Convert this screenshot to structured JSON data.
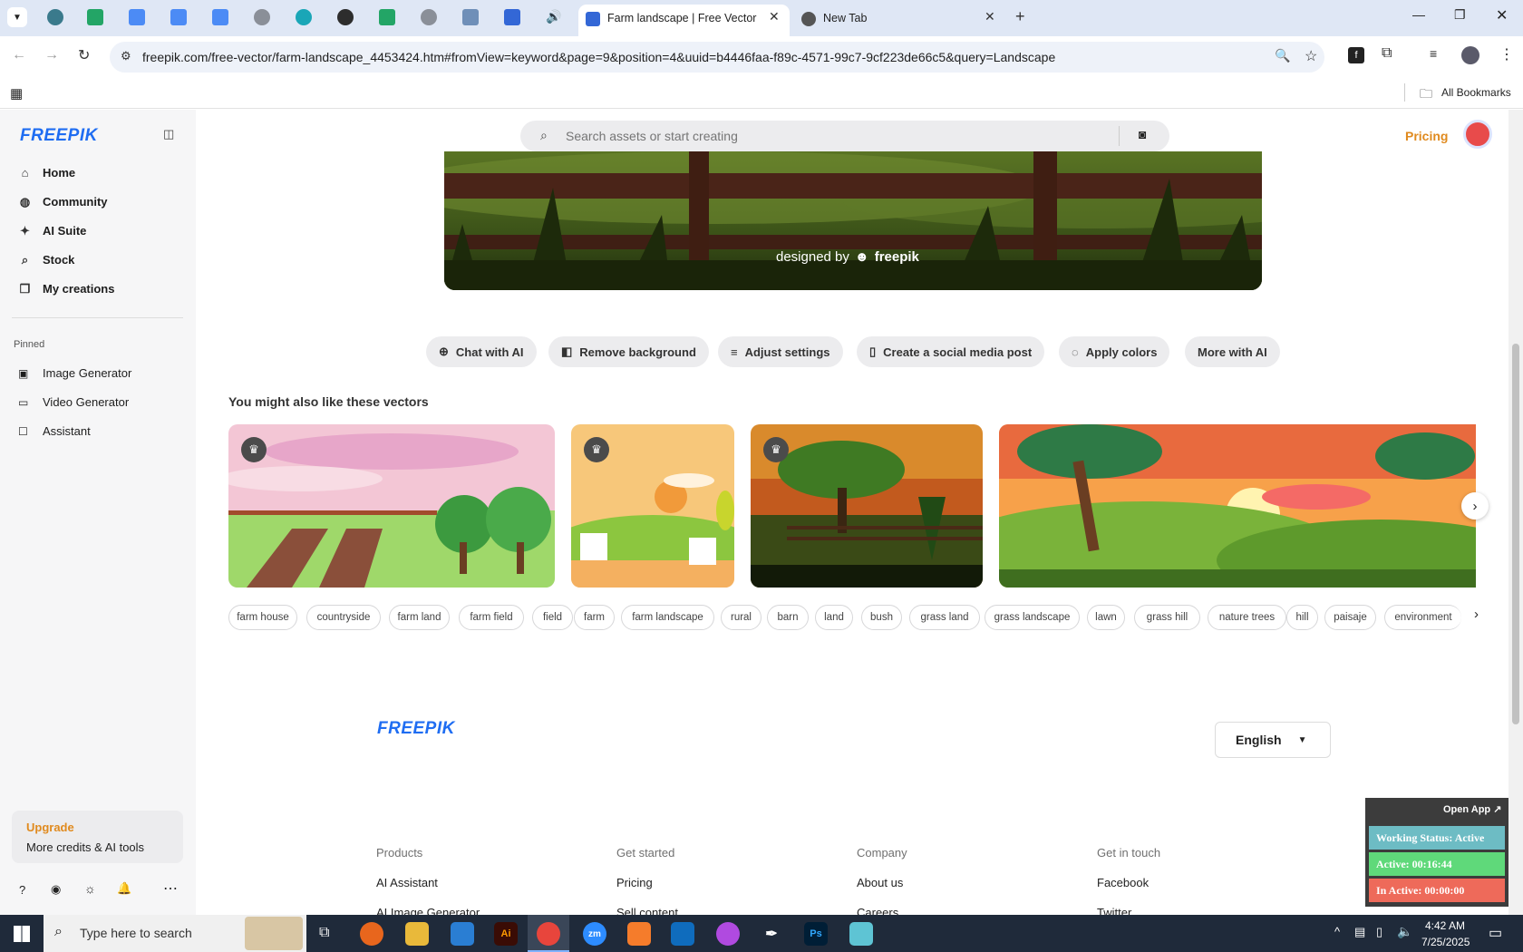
{
  "browser": {
    "active_tab_title": "Farm landscape | Free Vector",
    "second_tab_title": "New Tab",
    "url": "freepik.com/free-vector/farm-landscape_4453424.htm#fromView=keyword&page=9&position=4&uuid=b4446faa-f89c-4571-99c7-9cf223de66c5&query=Landscape",
    "all_bookmarks": "All Bookmarks",
    "colors": {
      "tabstrip": "#dfe7f5",
      "omnibox": "#eef2f9"
    }
  },
  "sidebar": {
    "logo": "FREEPIK",
    "nav": [
      {
        "label": "Home",
        "icon": "home-icon"
      },
      {
        "label": "Community",
        "icon": "globe-icon"
      },
      {
        "label": "AI Suite",
        "icon": "sparkle-icon"
      },
      {
        "label": "Stock",
        "icon": "search-icon"
      },
      {
        "label": "My creations",
        "icon": "folder-icon"
      }
    ],
    "pinned_heading": "Pinned",
    "pinned": [
      {
        "label": "Image Generator",
        "icon": "image-icon"
      },
      {
        "label": "Video Generator",
        "icon": "video-icon"
      },
      {
        "label": "Assistant",
        "icon": "chat-icon"
      }
    ],
    "upgrade": {
      "title": "Upgrade",
      "subtitle": "More credits & AI tools"
    }
  },
  "header": {
    "search_placeholder": "Search assets or start creating",
    "pricing": "Pricing"
  },
  "hero": {
    "credit": "designed by",
    "brand": "freepik"
  },
  "actions": [
    {
      "label": "Chat with AI",
      "icon": "chat-plus-icon"
    },
    {
      "label": "Remove background",
      "icon": "eraser-icon"
    },
    {
      "label": "Adjust settings",
      "icon": "sliders-icon"
    },
    {
      "label": "Create a social media post",
      "icon": "phone-icon"
    },
    {
      "label": "Apply colors",
      "icon": "palette-icon"
    },
    {
      "label": "More with AI",
      "icon": ""
    }
  ],
  "related": {
    "heading": "You might also like these vectors"
  },
  "tags": [
    "farm house",
    "countryside",
    "farm land",
    "farm field",
    "field",
    "farm",
    "farm landscape",
    "rural",
    "barn",
    "land",
    "bush",
    "grass land",
    "grass landscape",
    "lawn",
    "grass hill",
    "nature trees",
    "hill",
    "paisaje",
    "environment"
  ],
  "footer": {
    "logo": "FREEPIK",
    "language": "English",
    "columns": [
      {
        "heading": "Products",
        "links": [
          "AI Assistant",
          "AI Image Generator"
        ]
      },
      {
        "heading": "Get started",
        "links": [
          "Pricing",
          "Sell content"
        ]
      },
      {
        "heading": "Company",
        "links": [
          "About us",
          "Careers"
        ]
      },
      {
        "heading": "Get in touch",
        "links": [
          "Facebook",
          "Twitter"
        ]
      }
    ]
  },
  "widget": {
    "open_app": "Open App ↗",
    "working_status": "Working Status: Active",
    "active": "Active: 00:16:44",
    "inactive": "In Active: 00:00:00"
  },
  "taskbar": {
    "search_placeholder": "Type here to search",
    "time": "4:42 AM",
    "date": "7/25/2025"
  }
}
